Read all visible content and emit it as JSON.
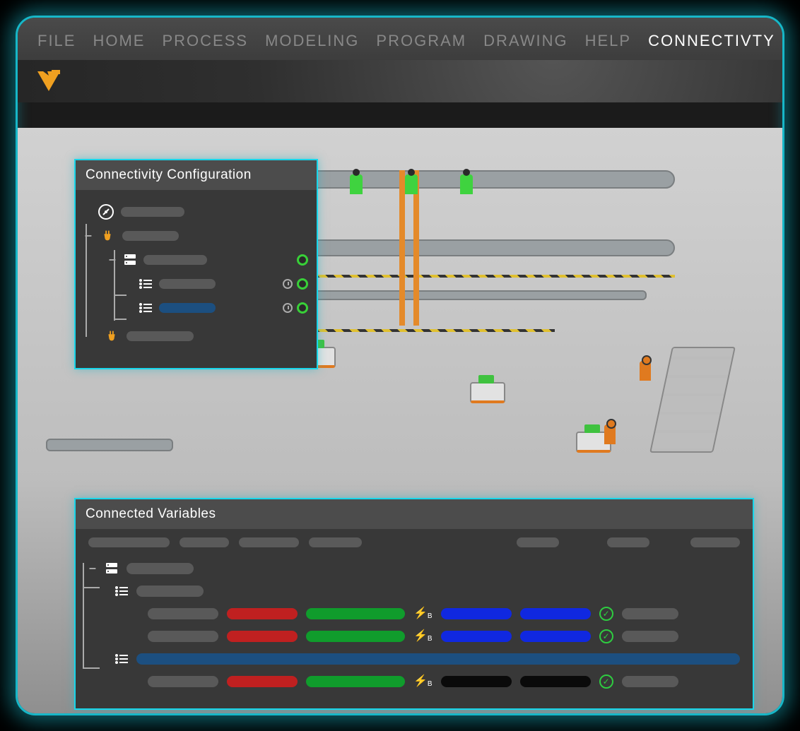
{
  "menu": {
    "items": [
      "FILE",
      "HOME",
      "PROCESS",
      "MODELING",
      "PROGRAM",
      "DRAWING",
      "HELP",
      "CONNECTIVTY"
    ],
    "active_index": 7
  },
  "brand": {
    "logo_name": "v-logo",
    "accent": "#f0a020"
  },
  "config_panel": {
    "title": "Connectivity Configuration",
    "rows": [
      {
        "id": "cloud",
        "indent": 0,
        "icon": "no-signal-icon",
        "expanded": null,
        "selected": false,
        "status": []
      },
      {
        "id": "plug1",
        "indent": 0,
        "icon": "plug-icon",
        "expanded": true,
        "selected": false,
        "status": []
      },
      {
        "id": "server",
        "indent": 1,
        "icon": "server-icon",
        "expanded": true,
        "selected": false,
        "status": [
          "power"
        ]
      },
      {
        "id": "list-a",
        "indent": 2,
        "icon": "list-icon",
        "expanded": null,
        "selected": false,
        "status": [
          "clock",
          "power"
        ]
      },
      {
        "id": "list-b",
        "indent": 2,
        "icon": "list-icon",
        "expanded": null,
        "selected": true,
        "status": [
          "clock",
          "power"
        ]
      },
      {
        "id": "plug2",
        "indent": 1,
        "icon": "plug-icon",
        "expanded": null,
        "selected": false,
        "status": []
      }
    ]
  },
  "vars_panel": {
    "title": "Connected Variables",
    "header_widths": [
      110,
      70,
      80,
      70,
      60,
      60,
      50,
      70,
      60,
      70
    ],
    "group": {
      "icon": "server-icon",
      "sub_lists": [
        {
          "icon": "list-icon",
          "rows": [
            {
              "cells": [
                "grey",
                "red",
                "green",
                "bolt",
                "blue",
                "blue",
                "check",
                "grey"
              ]
            },
            {
              "cells": [
                "grey",
                "red",
                "green",
                "bolt",
                "blue",
                "blue",
                "check",
                "grey"
              ]
            }
          ]
        },
        {
          "icon": "list-icon",
          "band": true,
          "rows": [
            {
              "cells": [
                "grey",
                "red",
                "green",
                "bolt",
                "black",
                "black",
                "check",
                "grey"
              ]
            }
          ]
        }
      ]
    }
  },
  "colors": {
    "accent": "#f0a020",
    "frame": "#17b7c8",
    "ok": "#2ecc40"
  }
}
